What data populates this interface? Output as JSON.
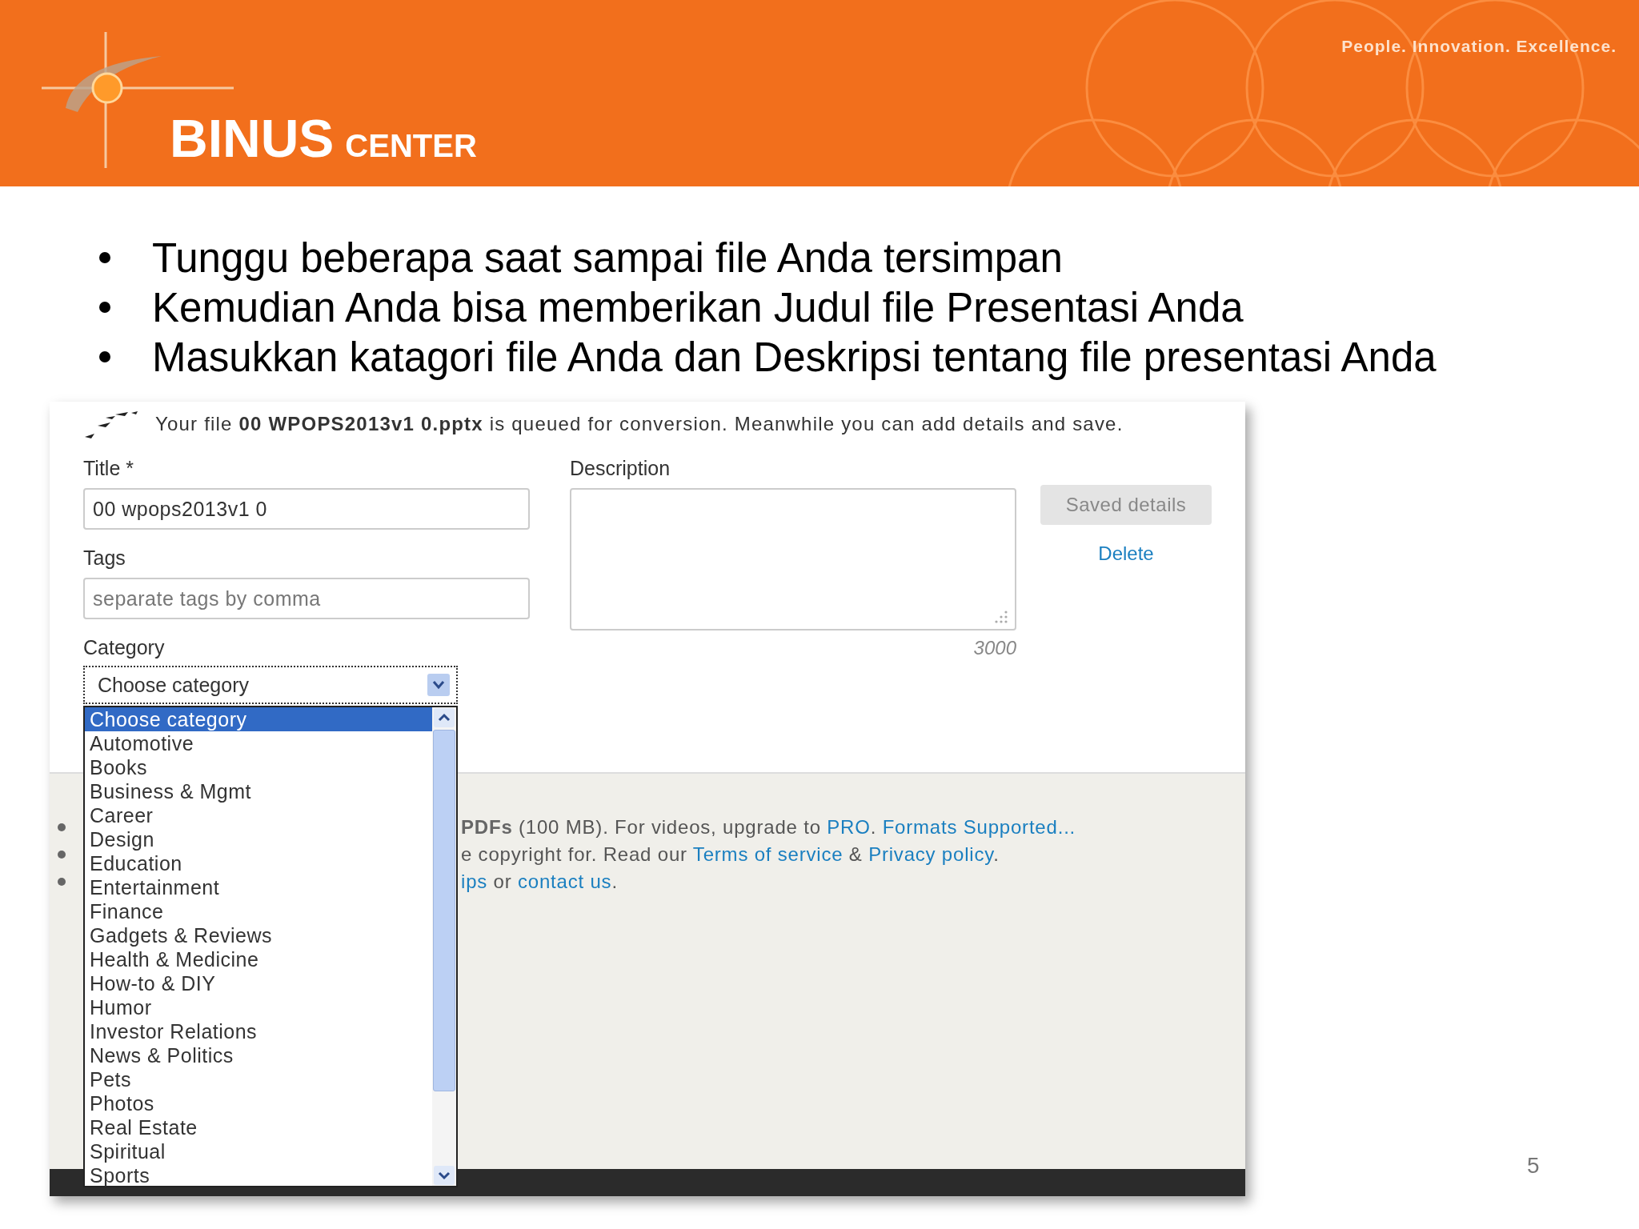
{
  "header": {
    "logo": {
      "name": "BINUS",
      "suffix": "CENTER"
    },
    "tagline": "People. Innovation. Excellence."
  },
  "bullets": [
    "Tunggu beberapa saat sampai file Anda tersimpan",
    "Kemudian Anda bisa memberikan Judul file Presentasi Anda",
    "Masukkan katagori file Anda dan Deskripsi tentang file presentasi Anda"
  ],
  "upload_form": {
    "notice": "Your file **00 WPOPS2013v1 0.pptx** is queued for conversion. Meanwhile you can add details and save.",
    "title": {
      "label": "Title *",
      "value": "00 wpops2013v1 0"
    },
    "tags": {
      "label": "Tags",
      "placeholder": "separate tags by comma"
    },
    "category": {
      "label": "Category",
      "value": "Choose category",
      "expanded": true,
      "options": [
        {
          "label": "Choose category",
          "selected": true
        },
        {
          "label": "Automotive",
          "selected": false
        },
        {
          "label": "Books",
          "selected": false
        },
        {
          "label": "Business & Mgmt",
          "selected": false
        },
        {
          "label": "Career",
          "selected": false
        },
        {
          "label": "Design",
          "selected": false
        },
        {
          "label": "Education",
          "selected": false
        },
        {
          "label": "Entertainment",
          "selected": false
        },
        {
          "label": "Finance",
          "selected": false
        },
        {
          "label": "Gadgets & Reviews",
          "selected": false
        },
        {
          "label": "Health & Medicine",
          "selected": false
        },
        {
          "label": "How-to & DIY",
          "selected": false
        },
        {
          "label": "Humor",
          "selected": false
        },
        {
          "label": "Investor Relations",
          "selected": false
        },
        {
          "label": "News & Politics",
          "selected": false
        },
        {
          "label": "Pets",
          "selected": false
        },
        {
          "label": "Photos",
          "selected": false
        },
        {
          "label": "Real Estate",
          "selected": false
        },
        {
          "label": "Spiritual",
          "selected": false
        },
        {
          "label": "Sports",
          "selected": false
        }
      ]
    },
    "description": {
      "label": "Description",
      "counter": "3000"
    },
    "save_button": {
      "label": "Saved details",
      "disabled": true
    },
    "delete_link": "Delete"
  },
  "footer_notes": [
    [
      {
        "kind": "bold",
        "text": "PDFs"
      },
      {
        "kind": "text",
        "text": " (100 MB). For videos, upgrade to "
      },
      {
        "kind": "link",
        "text": "PRO"
      },
      {
        "kind": "text",
        "text": ". "
      },
      {
        "kind": "link",
        "text": "Formats Supported..."
      }
    ],
    [
      {
        "kind": "text",
        "text": "e copyright for. Read our "
      },
      {
        "kind": "link",
        "text": "Terms of service"
      },
      {
        "kind": "text",
        "text": " & "
      },
      {
        "kind": "link",
        "text": "Privacy policy"
      },
      {
        "kind": "text",
        "text": "."
      }
    ],
    [
      {
        "kind": "link",
        "text": "ips"
      },
      {
        "kind": "text",
        "text": " or "
      },
      {
        "kind": "link",
        "text": "contact us"
      },
      {
        "kind": "text",
        "text": "."
      }
    ]
  ],
  "page_number": "5"
}
